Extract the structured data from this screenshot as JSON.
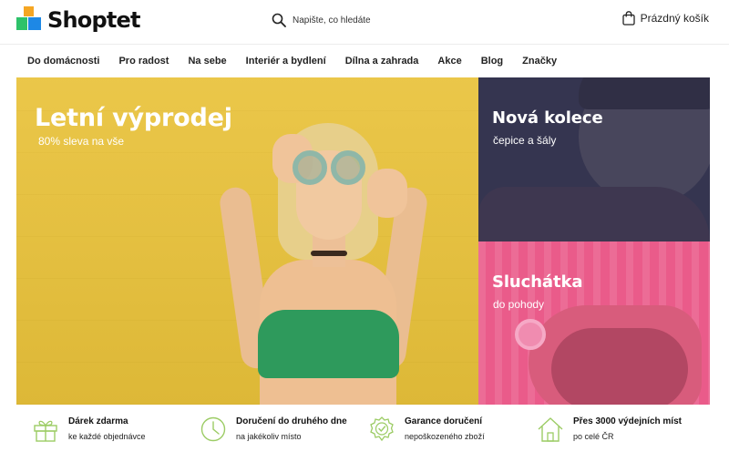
{
  "brand": {
    "name": "Shoptet",
    "colors": {
      "orange": "#f5a623",
      "green": "#2ec26a",
      "blue": "#1e88e5"
    }
  },
  "search": {
    "placeholder": "Napište, co hledáte",
    "icon": "search-icon"
  },
  "cart": {
    "label": "Prázdný košík",
    "icon": "shopping-bag-icon"
  },
  "nav": {
    "items": [
      {
        "label": "Do domácnosti"
      },
      {
        "label": "Pro radost"
      },
      {
        "label": "Na sebe"
      },
      {
        "label": "Interiér a bydlení"
      },
      {
        "label": "Dílna a zahrada"
      },
      {
        "label": "Akce"
      },
      {
        "label": "Blog"
      },
      {
        "label": "Značky"
      }
    ]
  },
  "hero": {
    "main": {
      "title": "Letní výprodej",
      "subtitle": "80% sleva na vše",
      "color": "#e9c23a"
    },
    "top": {
      "title": "Nová kolece",
      "subtitle": "čepice a šály",
      "color": "#45455e"
    },
    "bottom": {
      "title": "Sluchátka",
      "subtitle": "do pohody",
      "color": "#ea5b8a"
    }
  },
  "benefits": {
    "accent": "#9ccc65",
    "items": [
      {
        "icon": "gift-icon",
        "title": "Dárek zdarma",
        "subtitle": "ke každé objednávce"
      },
      {
        "icon": "clock-icon",
        "title": "Doručení do druhého dne",
        "subtitle": "na jakékoliv místo"
      },
      {
        "icon": "badge-check-icon",
        "title": "Garance doručení",
        "subtitle": "nepoškozeného zboží"
      },
      {
        "icon": "house-icon",
        "title": "Přes 3000 výdejních míst",
        "subtitle": "po celé ČR"
      }
    ]
  }
}
